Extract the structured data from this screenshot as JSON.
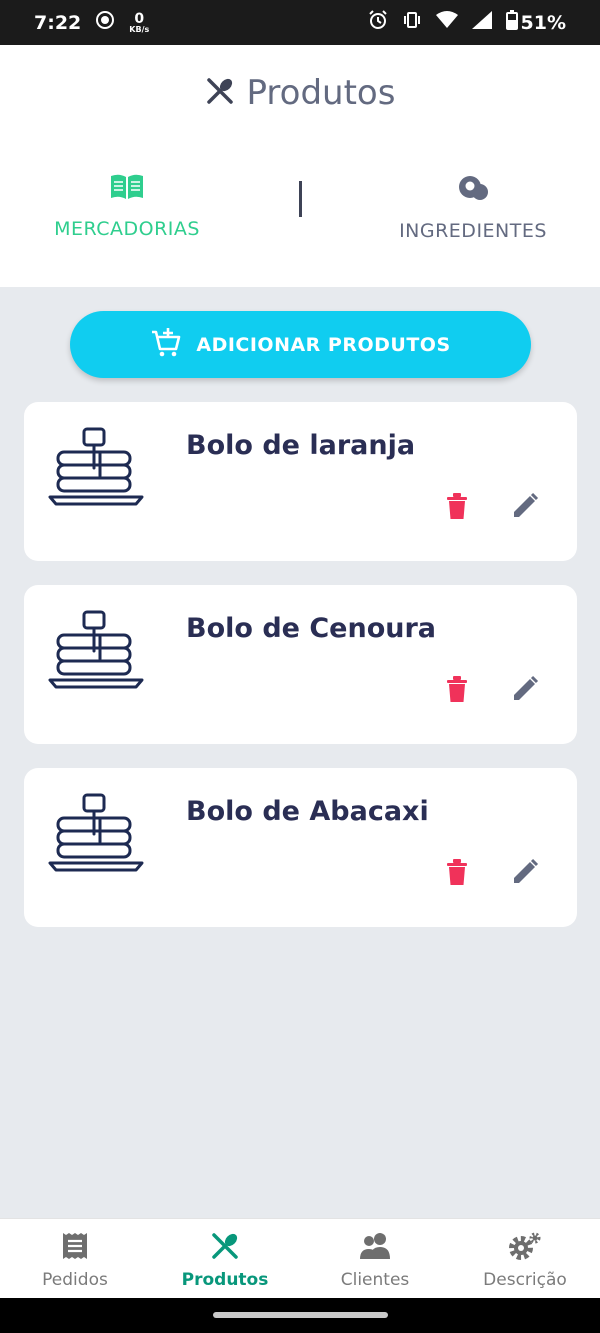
{
  "status_bar": {
    "time": "7:22",
    "speed_value": "0",
    "speed_unit": "KB/s",
    "battery": "51%"
  },
  "header": {
    "title": "Produtos",
    "tabs": [
      {
        "label": "MERCADORIAS",
        "active": true,
        "icon": "book-open-icon"
      },
      {
        "label": "INGREDIENTES",
        "active": false,
        "icon": "ingredient-icon"
      }
    ]
  },
  "add_button": {
    "label": "ADICIONAR PRODUTOS",
    "icon": "cart-plus-icon"
  },
  "products": [
    {
      "name": "Bolo de laranja"
    },
    {
      "name": "Bolo de Cenoura"
    },
    {
      "name": "Bolo de Abacaxi"
    }
  ],
  "bottom_nav": [
    {
      "label": "Pedidos",
      "icon": "receipt-icon",
      "active": false
    },
    {
      "label": "Produtos",
      "icon": "utensils-icon",
      "active": true
    },
    {
      "label": "Clientes",
      "icon": "users-icon",
      "active": false
    },
    {
      "label": "Descrição",
      "icon": "gears-icon",
      "active": false
    }
  ],
  "colors": {
    "accent_green": "#2fce8e",
    "nav_active": "#08977b",
    "button_cyan": "#10cdf0",
    "delete_red": "#f0325a",
    "text_dark": "#2a2e54",
    "text_gray": "#636a80"
  }
}
